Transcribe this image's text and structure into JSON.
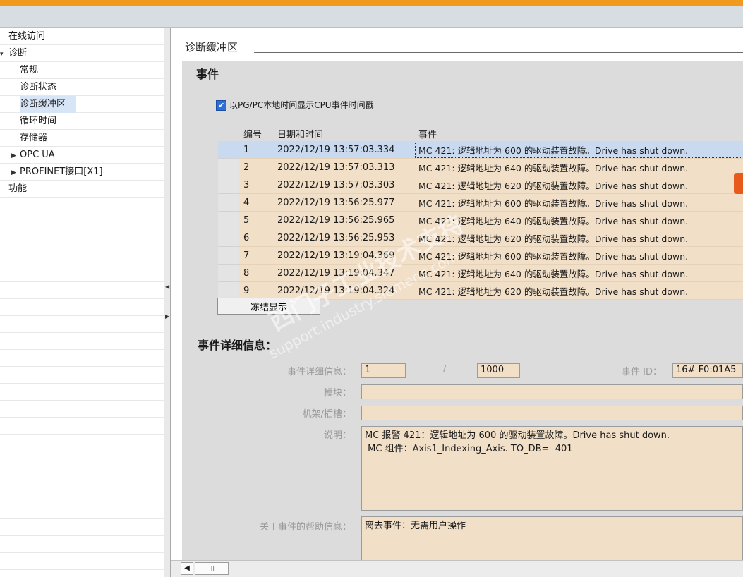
{
  "tree": {
    "items": [
      {
        "label": "在线访问",
        "indent": 0,
        "arrow": ""
      },
      {
        "label": "诊断",
        "indent": 0,
        "arrow": "▾"
      },
      {
        "label": "常规",
        "indent": 1,
        "arrow": ""
      },
      {
        "label": "诊断状态",
        "indent": 1,
        "arrow": ""
      },
      {
        "label": "诊断缓冲区",
        "indent": 1,
        "arrow": "",
        "selected": true
      },
      {
        "label": "循环时间",
        "indent": 1,
        "arrow": ""
      },
      {
        "label": "存储器",
        "indent": 1,
        "arrow": ""
      },
      {
        "label": "OPC UA",
        "indent": 1,
        "arrow": "▶"
      },
      {
        "label": "PROFINET接口[X1]",
        "indent": 1,
        "arrow": "▶"
      },
      {
        "label": "功能",
        "indent": 0,
        "arrow": ""
      }
    ]
  },
  "main": {
    "section_title": "诊断缓冲区",
    "events_heading": "事件",
    "checkbox_label": "以PG/PC本地时间显示CPU事件时间戳",
    "table": {
      "columns": [
        "编号",
        "日期和时间",
        "事件"
      ],
      "rows": [
        {
          "no": "1",
          "time": "2022/12/19 13:57:03.334",
          "event": "MC 421: 逻辑地址为 600 的驱动装置故障。Drive has shut down."
        },
        {
          "no": "2",
          "time": "2022/12/19 13:57:03.313",
          "event": "MC 421: 逻辑地址为 640 的驱动装置故障。Drive has shut down."
        },
        {
          "no": "3",
          "time": "2022/12/19 13:57:03.303",
          "event": "MC 421: 逻辑地址为 620 的驱动装置故障。Drive has shut down."
        },
        {
          "no": "4",
          "time": "2022/12/19 13:56:25.977",
          "event": "MC 421: 逻辑地址为 600 的驱动装置故障。Drive has shut down."
        },
        {
          "no": "5",
          "time": "2022/12/19 13:56:25.965",
          "event": "MC 421: 逻辑地址为 640 的驱动装置故障。Drive has shut down."
        },
        {
          "no": "6",
          "time": "2022/12/19 13:56:25.953",
          "event": "MC 421: 逻辑地址为 620 的驱动装置故障。Drive has shut down."
        },
        {
          "no": "7",
          "time": "2022/12/19 13:19:04.369",
          "event": "MC 421: 逻辑地址为 600 的驱动装置故障。Drive has shut down."
        },
        {
          "no": "8",
          "time": "2022/12/19 13:19:04.347",
          "event": "MC 421: 逻辑地址为 640 的驱动装置故障。Drive has shut down."
        },
        {
          "no": "9",
          "time": "2022/12/19 13:19:04.324",
          "event": "MC 421: 逻辑地址为 620 的驱动装置故障。Drive has shut down."
        }
      ]
    },
    "freeze_button": "冻结显示",
    "details_heading": "事件详细信息：",
    "details": {
      "detail_label": "事件详细信息：",
      "detail_value": "1",
      "detail_sep": "/",
      "detail_total": "1000",
      "event_id_label": "事件 ID：",
      "event_id_value": "16# F0:01A5",
      "module_label": "模块：",
      "module_value": "",
      "rack_label": "机架/插槽：",
      "rack_value": "",
      "desc_label": "说明：",
      "desc_value": "MC 报警 421：逻辑地址为 600 的驱动装置故障。Drive has shut down.\n MC 组件：Axis1_Indexing_Axis. TO_DB=  401",
      "help_label": "关于事件的帮助信息：",
      "help_value": "离去事件：无需用户操作"
    }
  },
  "watermark": {
    "line1": "西门子工业技术支持",
    "line2": "support.industry.siemens.com"
  },
  "colors": {
    "accent_bar": "#f29a1e",
    "row_bg": "#f1dfc8",
    "row_selected": "#c9d9ef"
  }
}
